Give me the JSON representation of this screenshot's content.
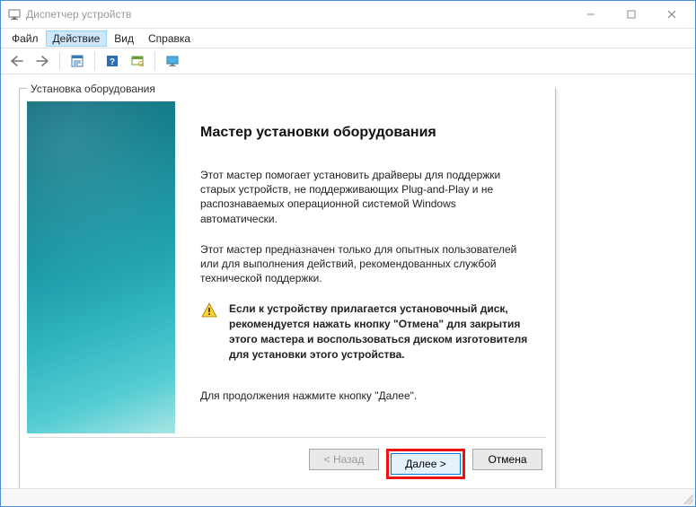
{
  "window": {
    "title": "Диспетчер устройств"
  },
  "menu": {
    "file": "Файл",
    "action": "Действие",
    "view": "Вид",
    "help": "Справка"
  },
  "wizard": {
    "frame_title": "Установка оборудования",
    "heading": "Мастер установки оборудования",
    "para1": "Этот мастер помогает установить драйверы для поддержки старых устройств, не поддерживающих Plug-and-Play и не распознаваемых операционной системой Windows автоматически.",
    "para2": "Этот мастер предназначен только для опытных пользователей или для выполнения действий, рекомендованных службой технической поддержки.",
    "warning": "Если к устройству прилагается установочный диск, рекомендуется нажать кнопку \"Отмена\" для закрытия этого мастера и воспользоваться диском изготовителя для установки этого устройства.",
    "continue": "Для продолжения нажмите кнопку \"Далее\".",
    "buttons": {
      "back": "< Назад",
      "next": "Далее >",
      "cancel": "Отмена"
    }
  }
}
